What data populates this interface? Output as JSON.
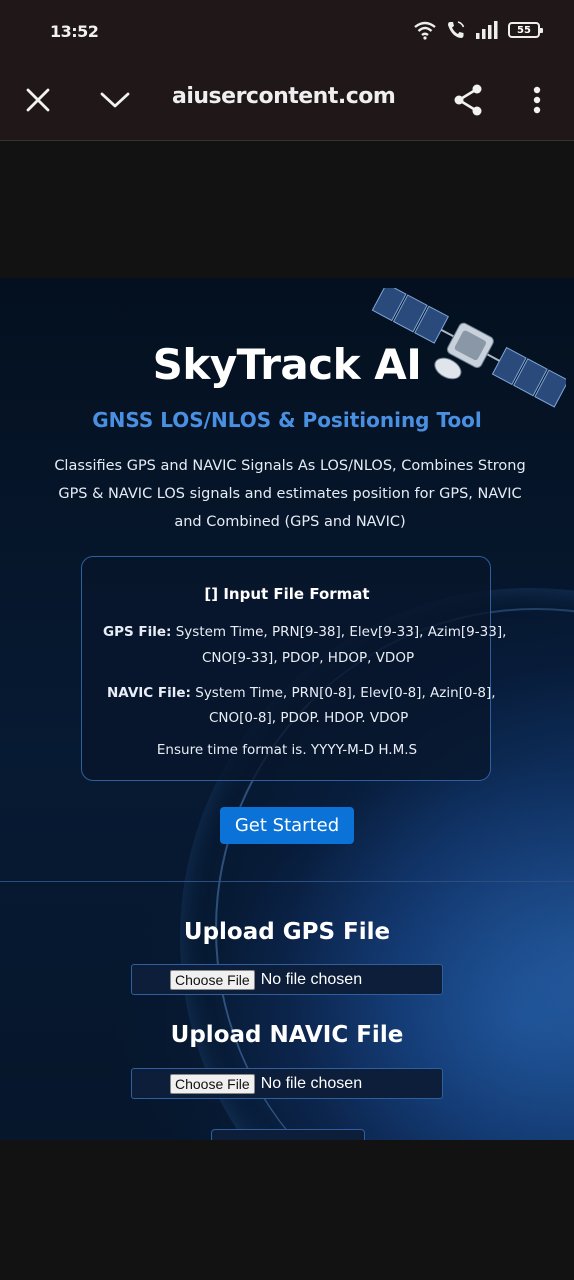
{
  "status_bar": {
    "time": "13:52",
    "battery": "55"
  },
  "browser": {
    "url": "aiusercontent.com"
  },
  "hero": {
    "title": "SkyTrack AI",
    "subtitle": "GNSS LOS/NLOS & Positioning Tool",
    "description": "Classifies GPS and NAVIC Signals As LOS/NLOS, Combines Strong GPS & NAVIC LOS signals and estimates position for GPS, NAVIC and Combined (GPS and NAVIC)"
  },
  "format_card": {
    "heading": "[] Input File Format",
    "gps_label": "GPS File:",
    "gps_line1": "System Time, PRN[9-38], Elev[9-33], Azim[9-33],",
    "gps_line2": "CNO[9-33], PDOP, HDOP, VDOP",
    "navic_label": "NAVIC File:",
    "navic_line1": "System Time, PRN[0-8], Elev[0-8], Azin[0-8],",
    "navic_line2": "CNO[0-8], PDOP. HDOP. VDOP",
    "time_note": "Ensure time format is. YYYY-M-D H.M.S"
  },
  "get_started_label": "Get Started",
  "upload": {
    "gps_title": "Upload GPS File",
    "navic_title": "Upload NAVIC File",
    "choose_label": "Choose File",
    "no_file": "No file chosen"
  },
  "colors": {
    "accent": "#0b73d8",
    "subtitle": "#4a90e2",
    "chrome": "#201719"
  }
}
